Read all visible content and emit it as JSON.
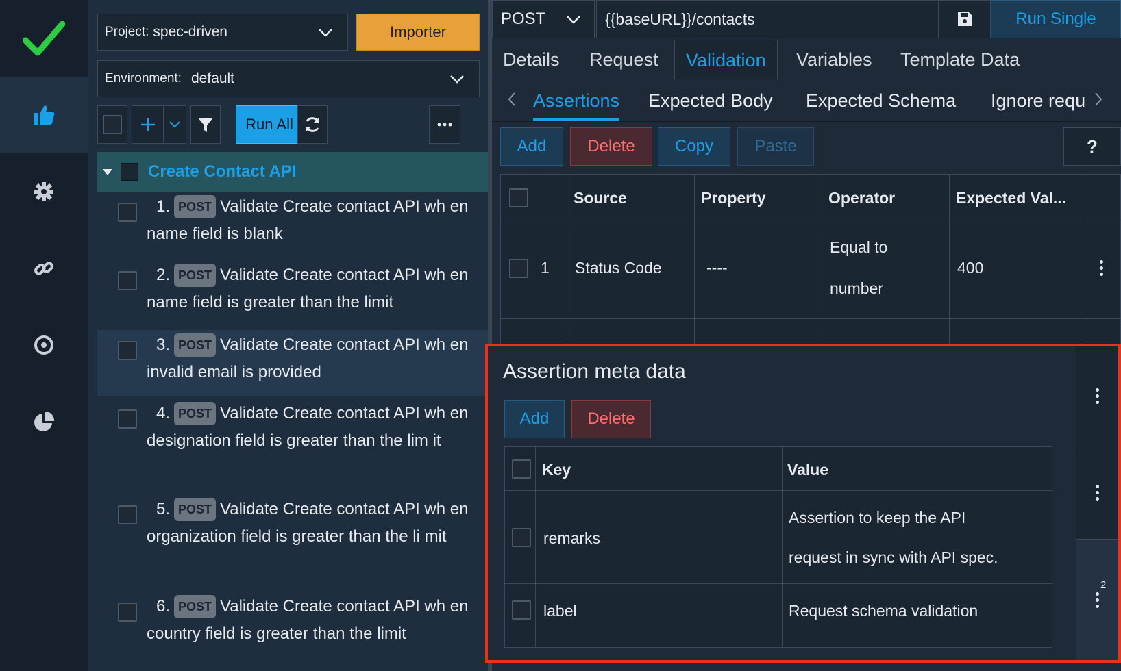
{
  "rail": {
    "items": [
      "check-logo",
      "thumbs-up-icon",
      "gear-icon",
      "link-icon",
      "target-icon",
      "pie-chart-icon"
    ]
  },
  "tree": {
    "project_label": "Project:",
    "project_value": "spec-driven",
    "importer_label": "Importer",
    "environment_label": "Environment:",
    "environment_value": "default",
    "run_all_label": "Run All",
    "group_name": "Create Contact API",
    "method_badge": "POST",
    "items": [
      {
        "num": "1.",
        "text": "Validate Create contact API wh en name field is blank"
      },
      {
        "num": "2.",
        "text": "Validate Create contact API wh en name field is greater than the limit"
      },
      {
        "num": "3.",
        "text": "Validate Create contact API wh en invalid email is provided"
      },
      {
        "num": "4.",
        "text": "Validate Create contact API wh en designation field is greater than the lim it"
      },
      {
        "num": "5.",
        "text": "Validate Create contact API wh en organization field is greater than the li mit"
      },
      {
        "num": "6.",
        "text": "Validate Create contact API wh en country field is greater than the limit"
      }
    ]
  },
  "request": {
    "method": "POST",
    "url": "{{baseURL}}/contacts",
    "run_single_label": "Run Single"
  },
  "tabs": [
    "Details",
    "Request",
    "Validation",
    "Variables",
    "Template Data"
  ],
  "subtabs": [
    "Assertions",
    "Expected Body",
    "Expected Schema",
    "Ignore requ"
  ],
  "assertion_buttons": {
    "add": "Add",
    "delete": "Delete",
    "copy": "Copy",
    "paste": "Paste",
    "help": "?"
  },
  "assertions_table": {
    "headers": [
      "Source",
      "Property",
      "Operator",
      "Expected Val..."
    ],
    "rows": [
      {
        "index": "1",
        "source": "Status Code",
        "property": "----",
        "operator_line1": "Equal to",
        "operator_line2": "number",
        "expected": "400"
      }
    ]
  },
  "meta_popup": {
    "title": "Assertion meta data",
    "add_label": "Add",
    "delete_label": "Delete",
    "headers": [
      "Key",
      "Value"
    ],
    "rows": [
      {
        "key": "remarks",
        "value_line1": "Assertion to keep the API",
        "value_line2": "request in sync with API spec."
      },
      {
        "key": "label",
        "value_line1": "Request schema validation"
      }
    ],
    "badge_count": "2"
  },
  "colors": {
    "accent": "#1ba0e8",
    "importer": "#e8a03a",
    "danger": "#ff6b6b",
    "highlight": "#e8321e"
  }
}
